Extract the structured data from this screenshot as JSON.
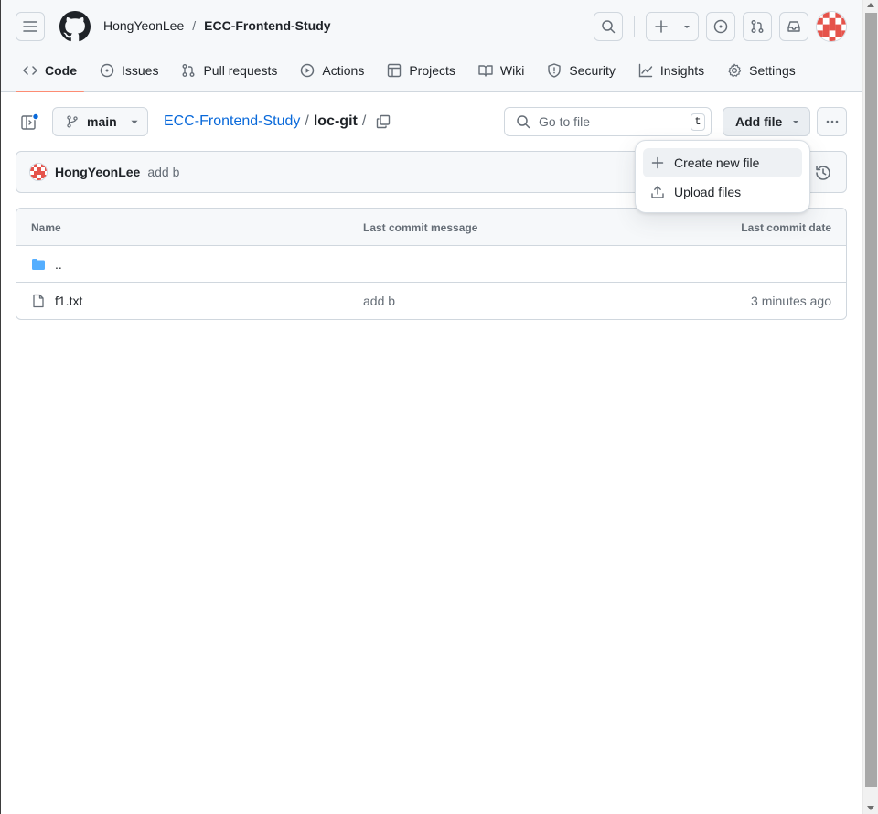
{
  "header": {
    "owner": "HongYeonLee",
    "separator": "/",
    "repo": "ECC-Frontend-Study"
  },
  "tabs": [
    {
      "label": "Code",
      "icon": "code-icon",
      "active": true
    },
    {
      "label": "Issues",
      "icon": "issue-icon"
    },
    {
      "label": "Pull requests",
      "icon": "pull-request-icon"
    },
    {
      "label": "Actions",
      "icon": "play-icon"
    },
    {
      "label": "Projects",
      "icon": "table-icon"
    },
    {
      "label": "Wiki",
      "icon": "book-icon"
    },
    {
      "label": "Security",
      "icon": "shield-icon"
    },
    {
      "label": "Insights",
      "icon": "graph-icon"
    },
    {
      "label": "Settings",
      "icon": "gear-icon"
    }
  ],
  "toolbar": {
    "branch": "main",
    "path_repo": "ECC-Frontend-Study",
    "path_sep": "/",
    "path_dir": "loc-git",
    "path_trail": "/",
    "goto_placeholder": "Go to file",
    "goto_shortcut": "t",
    "add_file": "Add file"
  },
  "commit": {
    "author": "HongYeonLee",
    "message": "add b"
  },
  "table": {
    "headers": {
      "name": "Name",
      "message": "Last commit message",
      "date": "Last commit date"
    },
    "rows": [
      {
        "name": "..",
        "type": "folder",
        "message": "",
        "date": ""
      },
      {
        "name": "f1.txt",
        "type": "file",
        "message": "add b",
        "date": "3 minutes ago"
      }
    ]
  },
  "dropdown": {
    "items": [
      {
        "label": "Create new file",
        "icon": "plus-icon"
      },
      {
        "label": "Upload files",
        "icon": "upload-icon"
      }
    ]
  },
  "colors": {
    "link": "#0969da",
    "active_tab_underline": "#fd8c73",
    "folder": "#54aeff",
    "avatar": "#e5534b"
  }
}
